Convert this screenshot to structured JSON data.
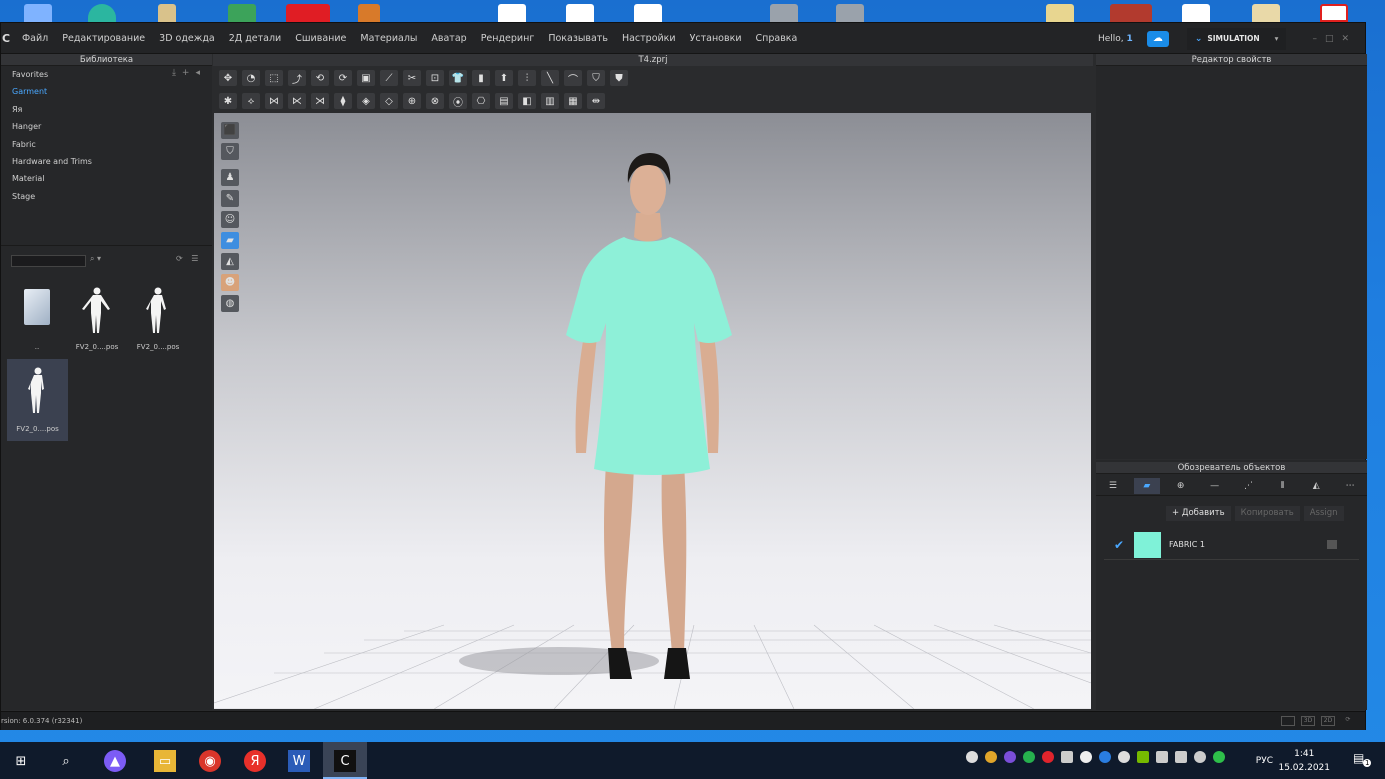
{
  "menubar": {
    "items": [
      "Файл",
      "Редактирование",
      "3D одежда",
      "2Д детали",
      "Сшивание",
      "Материалы",
      "Аватар",
      "Рендеринг",
      "Показывать",
      "Настройки",
      "Установки",
      "Справка"
    ],
    "hello_label": "Hello,",
    "hello_user": "1",
    "simulation_label": "SIMULATION"
  },
  "library": {
    "title": "Библиотека",
    "items": [
      "Favorites",
      "Garment",
      "Яя",
      "Hanger",
      "Fabric",
      "Hardware and Trims",
      "Material",
      "Stage"
    ],
    "active_index": 1,
    "thumbs": [
      "..",
      "FV2_0....pos",
      "FV2_0....pos",
      "FV2_0....pos"
    ]
  },
  "viewport": {
    "title": "T4.zprj"
  },
  "property_editor": {
    "title": "Редактор свойств"
  },
  "object_browser": {
    "title": "Обозреватель объектов",
    "add_label": "+ Добавить",
    "copy_label": "Копировать",
    "assign_label": "Assign",
    "fabric_name": "FABRIC 1",
    "fabric_color": "#7ff2d8"
  },
  "statusbar": {
    "version": "rsion: 6.0.374 (r32341)"
  },
  "taskbar": {
    "language": "РУС",
    "time": "1:41",
    "date": "15.02.2021",
    "notification_count": "1"
  },
  "colors": {
    "accent": "#4aa8ff",
    "dress": "#8ef0d8"
  }
}
